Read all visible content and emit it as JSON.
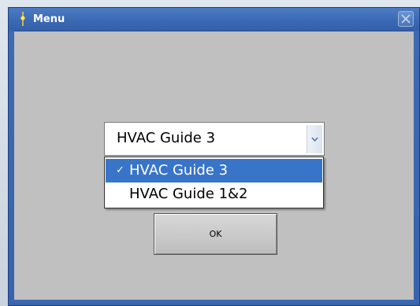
{
  "window": {
    "title": "Menu",
    "icon": "lightning-icon",
    "close_icon": "close-icon"
  },
  "colors": {
    "titlebar": "#3b69b4",
    "client_background": "#c0c0c0",
    "selection": "#3874c8"
  },
  "combo": {
    "value": "HVAC Guide 3",
    "arrow_icon": "chevron-down-icon"
  },
  "dropdown": {
    "options": [
      {
        "check": "✓",
        "label": "HVAC Guide 3",
        "selected": true
      },
      {
        "check": "",
        "label": "HVAC Guide 1&2",
        "selected": false
      }
    ]
  },
  "ok_button": {
    "label": "OK"
  }
}
